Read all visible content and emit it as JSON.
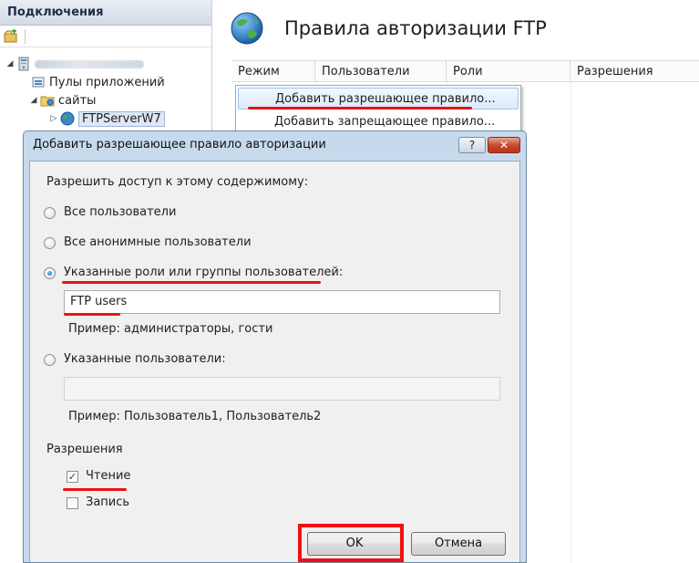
{
  "connections": {
    "title": "Подключения",
    "tree": {
      "app_pools": "Пулы приложений",
      "sites": "сайты",
      "site": "FTPServerW7"
    }
  },
  "main": {
    "title": "Правила авторизации FTP",
    "columns": [
      "Режим",
      "Пользователи",
      "Роли",
      "Разрешения"
    ]
  },
  "context_menu": {
    "items": [
      "Добавить разрешающее правило...",
      "Добавить запрещающее правило..."
    ]
  },
  "dialog": {
    "title": "Добавить разрешающее правило авторизации",
    "help_label": "?",
    "close_label": "✕",
    "access_label": "Разрешить доступ к этому содержимому:",
    "options": {
      "all_users": "Все пользователи",
      "all_anonymous": "Все анонимные пользователи",
      "roles": "Указанные роли или группы пользователей:",
      "users": "Указанные пользователи:"
    },
    "selected_option": "roles",
    "roles_value": "FTP users",
    "roles_example": "Пример: администраторы, гости",
    "users_value": "",
    "users_example": "Пример: Пользователь1, Пользователь2",
    "permissions_label": "Разрешения",
    "permissions": {
      "read": "Чтение",
      "write": "Запись"
    },
    "read_checked": true,
    "write_checked": false,
    "ok_label": "OK",
    "cancel_label": "Отмена"
  },
  "colors": {
    "annotation": "#ee1111",
    "dialog_frame": "#c7daed"
  }
}
